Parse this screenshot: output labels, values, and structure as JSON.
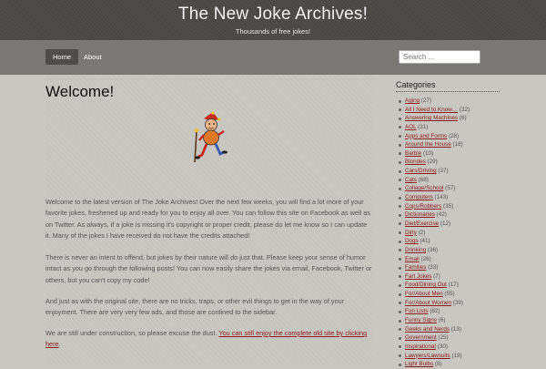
{
  "header": {
    "title": "The New Joke Archives!",
    "tagline": "Thousands of free jokes!"
  },
  "nav": {
    "items": [
      {
        "label": "Home"
      },
      {
        "label": "About"
      }
    ]
  },
  "search": {
    "placeholder": "Search ..."
  },
  "main": {
    "title": "Welcome!",
    "image_icon": "jester-icon",
    "p1": "Welcome to the latest version of The Joke Archives! Over the next few weeks, you will find a lot more of your favorite jokes, freshened up and ready for you to enjoy all over. You can follow this site on Facebook as well as on Twitter. As always, if a joke is missing it's copyright or proper credit, please do let me know so I can update it. Many of the jokes I have received do not have the credits attached!",
    "p2": "There is never an intent to offend, but jokes by their nature will do just that. Please keep your sense of humor intact as you go through the following posts! You can now easily share the jokes via email, Facebook, Twitter or others, but you can't copy my code!",
    "p3": "And just as with the original site, there are no tricks, traps, or other evil things to get in the way of your enjoyment. There are very very few ads, and those are confined to the sidebar.",
    "p4_text": "We are still under construction, so please excuse the dust. ",
    "p4_link": "You can still enjoy the complete old site by clicking here",
    "p4_end": "."
  },
  "sidebar": {
    "heading": "Categories",
    "categories": [
      {
        "name": "Aging",
        "count": "(27)"
      },
      {
        "name": "All I Need to Know…",
        "count": "(32)"
      },
      {
        "name": "Answering Machines",
        "count": "(6)"
      },
      {
        "name": "AOL",
        "count": "(31)"
      },
      {
        "name": "Apps and Forms",
        "count": "(28)"
      },
      {
        "name": "Around the House",
        "count": "(18)"
      },
      {
        "name": "Barbie",
        "count": "(10)"
      },
      {
        "name": "Blondes",
        "count": "(29)"
      },
      {
        "name": "Cars/Driving",
        "count": "(37)"
      },
      {
        "name": "Cats",
        "count": "(68)"
      },
      {
        "name": "Collage/School",
        "count": "(57)"
      },
      {
        "name": "Computers",
        "count": "(143)"
      },
      {
        "name": "Cops/Robbers",
        "count": "(35)"
      },
      {
        "name": "Dictionaries",
        "count": "(42)"
      },
      {
        "name": "Diet/Exercise",
        "count": "(12)"
      },
      {
        "name": "Dirty",
        "count": "(2)"
      },
      {
        "name": "Dogs",
        "count": "(41)"
      },
      {
        "name": "Drinking",
        "count": "(36)"
      },
      {
        "name": "Email",
        "count": "(26)"
      },
      {
        "name": "Families",
        "count": "(33)"
      },
      {
        "name": "Fart Jokes",
        "count": "(7)"
      },
      {
        "name": "Food/Dining Out",
        "count": "(17)"
      },
      {
        "name": "For/About Men",
        "count": "(55)"
      },
      {
        "name": "For/About Women",
        "count": "(39)"
      },
      {
        "name": "Fun Lists",
        "count": "(82)"
      },
      {
        "name": "Funny Signs",
        "count": "(6)"
      },
      {
        "name": "Geeks and Nerds",
        "count": "(13)"
      },
      {
        "name": "Government",
        "count": "(25)"
      },
      {
        "name": "Inspirational",
        "count": "(30)"
      },
      {
        "name": "Lawyers/Lawsuits",
        "count": "(19)"
      },
      {
        "name": "Light Bulbs",
        "count": "(8)"
      }
    ]
  }
}
